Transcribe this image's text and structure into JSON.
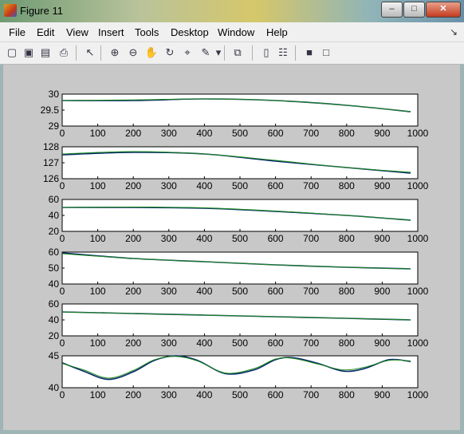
{
  "window": {
    "title": "Figure 11",
    "minimize": "–",
    "maximize": "□",
    "close": "✕"
  },
  "menu": [
    "File",
    "Edit",
    "View",
    "Insert",
    "Tools",
    "Desktop",
    "Window",
    "Help"
  ],
  "menu_overflow": "↘",
  "toolbar": [
    {
      "name": "new-figure-icon",
      "glyph": "▢"
    },
    {
      "name": "open-file-icon",
      "glyph": "▣"
    },
    {
      "name": "save-icon",
      "glyph": "▤"
    },
    {
      "name": "print-icon",
      "glyph": "⎙"
    },
    {
      "name": "edit-plot-arrow-icon",
      "glyph": "↖"
    },
    {
      "name": "zoom-in-icon",
      "glyph": "⊕"
    },
    {
      "name": "zoom-out-icon",
      "glyph": "⊖"
    },
    {
      "name": "pan-hand-icon",
      "glyph": "✋"
    },
    {
      "name": "rotate-3d-icon",
      "glyph": "↻"
    },
    {
      "name": "data-cursor-icon",
      "glyph": "⌖"
    },
    {
      "name": "brush-icon",
      "glyph": "✎"
    },
    {
      "name": "brush-dropdown-icon",
      "glyph": "▾"
    },
    {
      "name": "link-plot-icon",
      "glyph": "⧉"
    },
    {
      "name": "colorbar-icon",
      "glyph": "▯"
    },
    {
      "name": "legend-icon",
      "glyph": "☷"
    },
    {
      "name": "hide-plot-tools-icon",
      "glyph": "■"
    },
    {
      "name": "show-plot-tools-icon",
      "glyph": "□"
    }
  ],
  "colors": {
    "series_1": "#0a2a6e",
    "series_2": "#1a8a1a",
    "axes_bg": "#ffffff",
    "figure_bg": "#c8c8c8"
  },
  "chart_data": [
    {
      "type": "line",
      "xlim": [
        0,
        1000
      ],
      "ylim": [
        29,
        30
      ],
      "yticks": [
        "30",
        "29.5",
        "29"
      ],
      "xticks": [
        "0",
        "100",
        "200",
        "300",
        "400",
        "500",
        "600",
        "700",
        "800",
        "900",
        "1000"
      ],
      "x": [
        0,
        200,
        400,
        600,
        800,
        980
      ],
      "series": [
        {
          "values": [
            29.8,
            29.8,
            29.85,
            29.8,
            29.65,
            29.45
          ]
        },
        {
          "values": [
            29.8,
            29.82,
            29.85,
            29.8,
            29.65,
            29.45
          ]
        }
      ]
    },
    {
      "type": "line",
      "xlim": [
        0,
        1000
      ],
      "ylim": [
        126,
        128
      ],
      "yticks": [
        "128",
        "127",
        "126"
      ],
      "xticks": [
        "0",
        "100",
        "200",
        "300",
        "400",
        "500",
        "600",
        "700",
        "800",
        "900",
        "1000"
      ],
      "x": [
        0,
        200,
        400,
        600,
        800,
        980
      ],
      "series": [
        {
          "values": [
            127.5,
            127.65,
            127.55,
            127.1,
            126.7,
            126.35
          ]
        },
        {
          "values": [
            127.55,
            127.7,
            127.55,
            127.15,
            126.7,
            126.4
          ]
        }
      ]
    },
    {
      "type": "line",
      "xlim": [
        0,
        1000
      ],
      "ylim": [
        20,
        60
      ],
      "yticks": [
        "60",
        "40",
        "20"
      ],
      "xticks": [
        "0",
        "100",
        "200",
        "300",
        "400",
        "500",
        "600",
        "700",
        "800",
        "900",
        "1000"
      ],
      "x": [
        0,
        200,
        400,
        600,
        800,
        980
      ],
      "series": [
        {
          "values": [
            50,
            50,
            49,
            45,
            40,
            34
          ]
        },
        {
          "values": [
            50,
            50.5,
            49.5,
            45.5,
            40,
            34
          ]
        }
      ]
    },
    {
      "type": "line",
      "xlim": [
        0,
        1000
      ],
      "ylim": [
        40,
        60
      ],
      "yticks": [
        "60",
        "50",
        "40"
      ],
      "xticks": [
        "0",
        "100",
        "200",
        "300",
        "400",
        "500",
        "600",
        "700",
        "800",
        "900",
        "1000"
      ],
      "x": [
        0,
        200,
        400,
        600,
        800,
        980
      ],
      "series": [
        {
          "values": [
            59.5,
            56,
            54,
            52,
            50.5,
            49.5
          ]
        },
        {
          "values": [
            59,
            56,
            54,
            52,
            50.5,
            49.5
          ]
        }
      ]
    },
    {
      "type": "line",
      "xlim": [
        0,
        1000
      ],
      "ylim": [
        20,
        60
      ],
      "yticks": [
        "60",
        "40",
        "20"
      ],
      "xticks": [
        "0",
        "100",
        "200",
        "300",
        "400",
        "500",
        "600",
        "700",
        "800",
        "900",
        "1000"
      ],
      "x": [
        0,
        200,
        400,
        600,
        800,
        980
      ],
      "series": [
        {
          "values": [
            50,
            48,
            46,
            44,
            42,
            40
          ]
        },
        {
          "values": [
            50,
            48,
            46,
            44,
            42,
            40
          ]
        }
      ]
    },
    {
      "type": "line",
      "xlim": [
        0,
        1000
      ],
      "ylim": [
        40,
        45
      ],
      "yticks": [
        "45",
        "40"
      ],
      "xticks": [
        "0",
        "100",
        "200",
        "300",
        "400",
        "500",
        "600",
        "700",
        "800",
        "900",
        "1000"
      ],
      "x": [
        0,
        60,
        130,
        200,
        260,
        320,
        380,
        460,
        540,
        600,
        650,
        720,
        790,
        850,
        920,
        980
      ],
      "series": [
        {
          "values": [
            43.9,
            42.6,
            41.3,
            42.5,
            44.3,
            45.0,
            44.3,
            42.2,
            42.8,
            44.4,
            44.7,
            43.8,
            42.6,
            43.0,
            44.4,
            44.1
          ]
        },
        {
          "values": [
            43.8,
            42.8,
            41.5,
            42.7,
            44.4,
            44.9,
            44.2,
            42.3,
            43.0,
            44.5,
            44.6,
            43.7,
            42.8,
            43.2,
            44.3,
            44.2
          ]
        }
      ]
    }
  ]
}
